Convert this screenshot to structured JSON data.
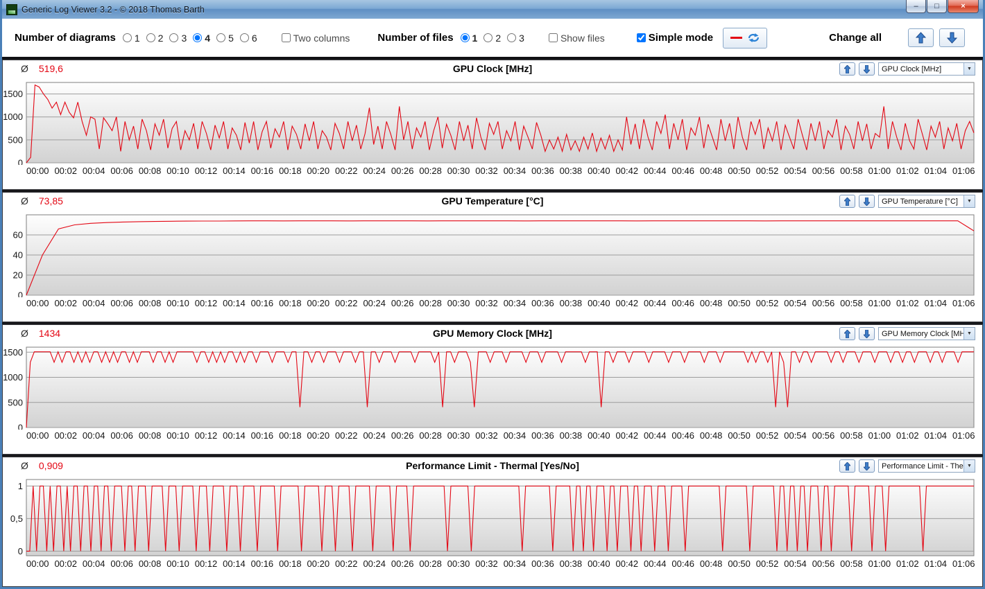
{
  "window": {
    "title": "Generic Log Viewer 3.2 - © 2018 Thomas Barth",
    "minimize_glyph": "–",
    "maximize_glyph": "□",
    "close_glyph": "×"
  },
  "icons": {
    "dropdown_arrow": "▼"
  },
  "toolbar": {
    "diagrams_label": "Number of diagrams",
    "diagram_options": [
      "1",
      "2",
      "3",
      "4",
      "5",
      "6"
    ],
    "diagrams_selected": "4",
    "two_columns_label": "Two columns",
    "files_label": "Number of files",
    "file_options": [
      "1",
      "2",
      "3"
    ],
    "files_selected": "1",
    "show_files_label": "Show files",
    "simple_mode_label": "Simple mode",
    "change_all_label": "Change all"
  },
  "avg_prefix": "Ø",
  "x_labels": [
    "00:00",
    "00:02",
    "00:04",
    "00:06",
    "00:08",
    "00:10",
    "00:12",
    "00:14",
    "00:16",
    "00:18",
    "00:20",
    "00:22",
    "00:24",
    "00:26",
    "00:28",
    "00:30",
    "00:32",
    "00:34",
    "00:36",
    "00:38",
    "00:40",
    "00:42",
    "00:44",
    "00:46",
    "00:48",
    "00:50",
    "00:52",
    "00:54",
    "00:56",
    "00:58",
    "01:00",
    "01:02",
    "01:04",
    "01:06"
  ],
  "chart_data": [
    {
      "type": "line",
      "title": "GPU Clock [MHz]",
      "average": "519,6",
      "dropdown_value": "GPU Clock [MHz]",
      "color": "#e30613",
      "ylim": [
        0,
        1750
      ],
      "yticks": [
        0,
        500,
        1000,
        1500
      ],
      "ytick_labels": [
        "0",
        "500",
        "1000",
        "1500"
      ],
      "x_range_minutes": [
        0,
        66
      ],
      "values": [
        0,
        120,
        1695,
        1650,
        1500,
        1380,
        1190,
        1322,
        1050,
        1322,
        1100,
        980,
        1322,
        900,
        600,
        1000,
        950,
        300,
        980,
        850,
        700,
        1000,
        250,
        900,
        500,
        800,
        300,
        950,
        700,
        280,
        850,
        600,
        950,
        320,
        750,
        900,
        280,
        700,
        500,
        860,
        300,
        900,
        640,
        280,
        820,
        540,
        900,
        300,
        760,
        600,
        280,
        880,
        430,
        900,
        280,
        680,
        900,
        320,
        740,
        560,
        900,
        280,
        800,
        620,
        300,
        850,
        480,
        900,
        300,
        700,
        560,
        280,
        860,
        640,
        300,
        900,
        480,
        820,
        300,
        640,
        1200,
        400,
        800,
        300,
        900,
        620,
        280,
        1230,
        500,
        900,
        300,
        760,
        560,
        900,
        280,
        700,
        1000,
        320,
        840,
        600,
        280,
        900,
        480,
        820,
        300,
        980,
        560,
        280,
        860,
        620,
        900,
        300,
        700,
        480,
        900,
        280,
        800,
        560,
        300,
        880,
        600,
        250,
        500,
        300,
        560,
        250,
        620,
        280,
        480,
        250,
        560,
        300,
        650,
        250,
        540,
        300,
        600,
        250,
        500,
        280,
        1000,
        400,
        850,
        300,
        950,
        560,
        280,
        900,
        640,
        1050,
        300,
        860,
        500,
        950,
        280,
        760,
        600,
        1000,
        320,
        840,
        560,
        280,
        950,
        480,
        860,
        300,
        1000,
        560,
        280,
        900,
        620,
        950,
        300,
        760,
        480,
        900,
        280,
        820,
        560,
        300,
        950,
        600,
        280,
        860,
        480,
        900,
        300,
        700,
        560,
        950,
        280,
        800,
        620,
        300,
        900,
        480,
        850,
        300,
        640,
        560,
        1230,
        300,
        900,
        560,
        280,
        860,
        480,
        300,
        950,
        620,
        280,
        800,
        560,
        900,
        300,
        760,
        480,
        860,
        300,
        700,
        900,
        650
      ]
    },
    {
      "type": "line",
      "title": "GPU Temperature [°C]",
      "average": "73,85",
      "dropdown_value": "GPU Temperature [°C]",
      "color": "#e30613",
      "ylim": [
        0,
        80
      ],
      "yticks": [
        0,
        20,
        40,
        60
      ],
      "ytick_labels": [
        "0",
        "20",
        "40",
        "60"
      ],
      "x_range_minutes": [
        0,
        66
      ],
      "values": [
        0,
        40,
        66,
        70,
        71.5,
        72.3,
        72.8,
        73.2,
        73.4,
        73.6,
        73.7,
        73.8,
        73.8,
        73.9,
        74,
        74,
        73.9,
        74,
        74,
        74,
        73.9,
        74,
        74,
        74,
        74,
        73.9,
        74,
        74,
        74,
        74,
        74,
        73.9,
        74,
        74,
        74,
        74,
        74,
        74,
        73.9,
        74,
        74,
        74,
        74,
        74,
        74,
        74,
        73.9,
        74,
        74,
        74,
        74,
        74,
        74,
        74,
        74,
        74,
        74,
        74,
        74,
        64
      ]
    },
    {
      "type": "line",
      "title": "GPU Memory Clock [MHz]",
      "average": "1434",
      "dropdown_value": "GPU Memory Clock [MHz]",
      "color": "#e30613",
      "ylim": [
        0,
        1600
      ],
      "yticks": [
        0,
        500,
        1000,
        1500
      ],
      "ytick_labels": [
        "0",
        "500",
        "1000",
        "1500"
      ],
      "x_range_minutes": [
        0,
        66
      ],
      "values": [
        0,
        1300,
        1508,
        1508,
        1508,
        1508,
        1508,
        1300,
        1508,
        1300,
        1508,
        1508,
        1300,
        1508,
        1300,
        1508,
        1300,
        1508,
        1508,
        1300,
        1508,
        1300,
        1508,
        1300,
        1508,
        1508,
        1300,
        1508,
        1300,
        1508,
        1508,
        1508,
        1300,
        1508,
        1508,
        1300,
        1508,
        1300,
        1508,
        1508,
        1508,
        1508,
        1508,
        1300,
        1508,
        1508,
        1300,
        1508,
        1300,
        1508,
        1300,
        1508,
        1508,
        1300,
        1508,
        1300,
        1508,
        1508,
        1300,
        1508,
        1508,
        1508,
        1300,
        1508,
        1508,
        1508,
        1300,
        1508,
        1508,
        405,
        1508,
        1508,
        1300,
        1508,
        1508,
        1300,
        1508,
        1508,
        1508,
        1300,
        1508,
        1508,
        1508,
        1300,
        1508,
        1508,
        405,
        1508,
        1508,
        1300,
        1508,
        1508,
        1508,
        1300,
        1508,
        1508,
        1508,
        1508,
        1300,
        1508,
        1508,
        1508,
        1508,
        1300,
        1508,
        405,
        1508,
        1508,
        1300,
        1508,
        1508,
        1508,
        1300,
        405,
        1508,
        1508,
        1508,
        1300,
        1508,
        1508,
        1508,
        1300,
        1508,
        1508,
        1508,
        1508,
        1300,
        1508,
        1508,
        1508,
        1300,
        1508,
        1508,
        1508,
        1508,
        1300,
        1508,
        1508,
        1508,
        1508,
        1508,
        1300,
        1508,
        1508,
        1508,
        405,
        1508,
        1508,
        1300,
        1508,
        1508,
        1508,
        1300,
        1508,
        1508,
        1508,
        1508,
        1300,
        1508,
        1508,
        1508,
        1508,
        1300,
        1508,
        1508,
        1508,
        1300,
        1508,
        1508,
        1508,
        1508,
        1300,
        1508,
        1508,
        1508,
        1300,
        1508,
        1508,
        1508,
        1508,
        1508,
        1508,
        1300,
        1508,
        1300,
        1508,
        1508,
        1300,
        1508,
        405,
        1508,
        1300,
        405,
        1508,
        1508,
        1300,
        1508,
        1508,
        1300,
        1508,
        1508,
        1508,
        1508,
        1300,
        1508,
        1508,
        1300,
        1508,
        1508,
        1508,
        1300,
        1508,
        1508,
        1508,
        1300,
        1508,
        1508,
        1508,
        1300,
        1508,
        1508,
        1300,
        1508,
        1508,
        1300,
        1508,
        1508,
        1508,
        1300,
        1508,
        1508,
        1300,
        1508,
        1508,
        1508,
        1300,
        1508,
        1508,
        1508,
        1508
      ]
    },
    {
      "type": "line",
      "title": "Performance Limit - Thermal [Yes/No]",
      "average": "0,909",
      "dropdown_value": "Performance Limit - Therm",
      "color": "#e30613",
      "ylim": [
        -0.07,
        1.1
      ],
      "yticks": [
        0,
        0.5,
        1
      ],
      "ytick_labels": [
        "0",
        "0,5",
        "1"
      ],
      "x_range_minutes": [
        0,
        66
      ],
      "values": [
        0,
        0,
        1,
        0,
        1,
        1,
        0,
        1,
        0,
        1,
        1,
        0,
        1,
        0,
        1,
        1,
        0,
        1,
        1,
        0,
        1,
        1,
        0,
        1,
        1,
        0,
        1,
        1,
        1,
        0,
        1,
        1,
        0,
        1,
        1,
        1,
        0,
        1,
        1,
        1,
        1,
        0,
        1,
        1,
        1,
        0,
        1,
        1,
        1,
        1,
        0,
        1,
        1,
        1,
        0,
        1,
        1,
        1,
        1,
        0,
        1,
        1,
        1,
        0,
        1,
        1,
        1,
        1,
        0,
        1,
        1,
        1,
        1,
        1,
        0,
        1,
        1,
        1,
        1,
        1,
        1,
        0,
        1,
        1,
        1,
        1,
        1,
        0,
        1,
        1,
        1,
        0,
        1,
        1,
        1,
        1,
        0,
        1,
        1,
        1,
        1,
        1,
        0,
        1,
        1,
        1,
        1,
        1,
        0,
        1,
        1,
        1,
        1,
        0,
        1,
        1,
        1,
        1,
        1,
        1,
        1,
        1,
        1,
        1,
        0,
        1,
        1,
        1,
        1,
        1,
        1,
        0,
        1,
        1,
        1,
        1,
        1,
        1,
        1,
        1,
        1,
        1,
        1,
        1,
        1,
        1,
        0,
        1,
        1,
        1,
        1,
        1,
        1,
        1,
        1,
        0,
        1,
        1,
        1,
        1,
        1,
        0,
        1,
        1,
        0,
        1,
        1,
        0,
        1,
        1,
        1,
        0,
        1,
        1,
        0,
        1,
        1,
        1,
        0,
        1,
        1,
        0,
        1,
        1,
        1,
        0,
        1,
        1,
        1,
        0,
        1,
        1,
        1,
        1,
        0,
        1,
        1,
        1,
        1,
        1,
        1,
        1,
        1,
        1,
        1,
        0,
        1,
        1,
        1,
        1,
        1,
        1,
        1,
        0,
        1,
        1,
        1,
        1,
        1,
        1,
        1,
        0,
        1,
        1,
        0,
        1,
        1,
        0,
        1,
        1,
        0,
        1,
        1,
        1,
        0,
        1,
        1,
        0,
        1,
        1,
        1,
        1,
        1,
        0,
        1,
        1,
        1,
        1,
        1,
        0,
        1,
        1,
        1,
        0,
        1,
        1,
        1,
        1,
        1,
        1,
        1,
        1,
        1,
        1,
        0,
        1,
        1,
        1,
        1,
        1,
        1,
        1,
        1,
        1,
        1,
        1,
        1,
        1,
        1,
        1
      ]
    }
  ]
}
